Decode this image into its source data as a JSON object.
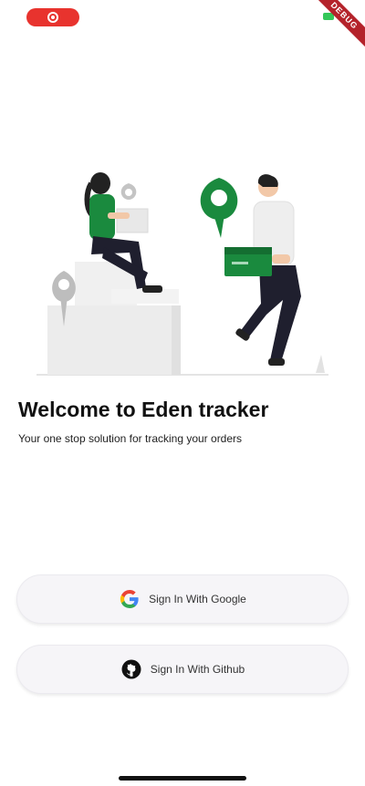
{
  "status_bar": {
    "record_icon": "screen-record-icon",
    "battery_icon": "battery-icon"
  },
  "debug_banner": {
    "label": "DEBUG",
    "color": "#b4222a"
  },
  "illustration": {
    "icon": "delivery-illustration",
    "accent_color": "#1a8a3e"
  },
  "welcome": {
    "title": "Welcome to Eden tracker",
    "subtitle": "Your one stop solution for tracking your orders"
  },
  "buttons": {
    "google": {
      "label": "Sign In With Google",
      "icon": "google-icon"
    },
    "github": {
      "label": "Sign In With Github",
      "icon": "github-icon"
    }
  }
}
